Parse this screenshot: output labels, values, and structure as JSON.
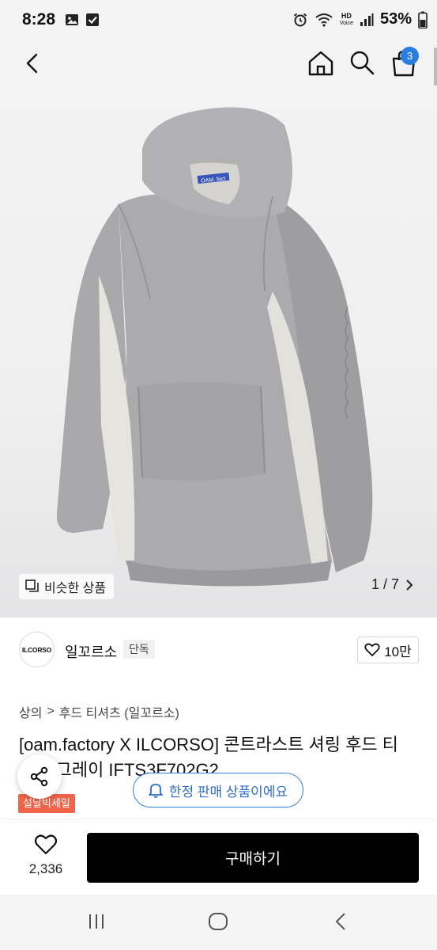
{
  "status_bar": {
    "time": "8:28",
    "hd_label": "HD",
    "voice_label": "Voice",
    "battery": "53%"
  },
  "header": {
    "cart_count": "3"
  },
  "gallery": {
    "similar_label": "비슷한 상품",
    "counter": "1 / 7",
    "garment_label": "OAM. fact"
  },
  "brand": {
    "logo_text": "ILCORSO",
    "name": "일꼬르소",
    "exclusive_tag": "단독",
    "likes": "10만"
  },
  "breadcrumb": {
    "level1": "상의",
    "separator": ">",
    "level2": "후드 티셔츠 (일꼬르소)"
  },
  "product": {
    "title": "[oam.factory X ILCORSO] 콘트라스트 셔링 후드 티셔츠 그레이 IFTS3F702G2",
    "sale_badge": "설날빅세일"
  },
  "floating": {
    "limited_notice": "한정 판매 상품이에요"
  },
  "purchase": {
    "wish_count": "2,336",
    "buy_label": "구매하기"
  },
  "colors": {
    "accent_blue": "#2a7de1",
    "sale_red": "#f26449",
    "buy_black": "#000000"
  }
}
